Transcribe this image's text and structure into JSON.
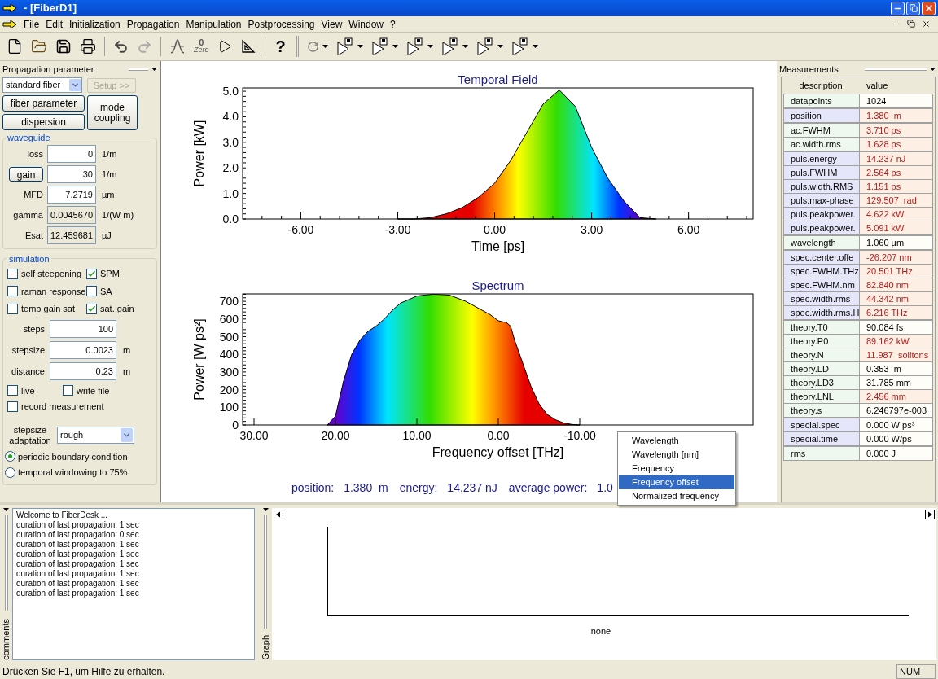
{
  "window": {
    "title": "- [FiberD1]"
  },
  "menu": [
    "File",
    "Edit",
    "Initialization",
    "Propagation",
    "Manipulation",
    "Postprocessing",
    "View",
    "Window",
    "?"
  ],
  "toolbar": {
    "zero_digit": "0",
    "zero_caption": "Zero",
    "help": "?"
  },
  "propagation_panel": {
    "title": "Propagation parameter",
    "fiber_type": "standard fiber",
    "setup_button": {
      "label": "Setup >>",
      "disabled": true
    },
    "buttons": [
      "fiber parameter",
      "dispersion"
    ],
    "mode_button": "mode coupling"
  },
  "waveguide": {
    "title": "waveguide",
    "fields": [
      {
        "label": "loss",
        "kind": "text",
        "value": "0",
        "unit": "1/m",
        "readonly": false
      },
      {
        "label": "gain",
        "kind": "button",
        "value": "30",
        "unit": "1/m",
        "readonly": false
      },
      {
        "label": "MFD",
        "kind": "text",
        "value": "7.2719",
        "unit": "µm",
        "readonly": false
      },
      {
        "label": "gamma",
        "kind": "text",
        "value": "0.0045670",
        "unit": "1/(W m)",
        "readonly": true
      },
      {
        "label": "Esat",
        "kind": "text",
        "value": "12.459681",
        "unit": "µJ",
        "readonly": true
      }
    ]
  },
  "simulation": {
    "title": "simulation",
    "options": [
      {
        "label": "self steepening",
        "checked": false
      },
      {
        "label": "SPM",
        "checked": true
      },
      {
        "label": "raman response",
        "checked": false
      },
      {
        "label": "SA",
        "checked": false
      },
      {
        "label": "temp gain sat",
        "checked": false
      },
      {
        "label": "sat. gain",
        "checked": true
      }
    ],
    "fields": [
      {
        "label": "steps",
        "value": "100"
      },
      {
        "label": "stepsize",
        "value": "0.0023",
        "unit": "m"
      },
      {
        "label": "distance",
        "value": "0.23",
        "unit": "m"
      }
    ],
    "output_options": [
      {
        "label": "live",
        "checked": false
      },
      {
        "label": "write file",
        "checked": false
      },
      {
        "label": "record measurement",
        "checked": false
      }
    ],
    "adaptation": {
      "label": "stepsize adaptation",
      "value": "rough"
    },
    "boundary": [
      {
        "label": "periodic boundary condition",
        "selected": true
      },
      {
        "label": "temporal windowing to 75%",
        "selected": false
      }
    ]
  },
  "temporal_plot": {
    "chart_data": {
      "type": "area",
      "title": "Temporal Field",
      "xlabel": "Time [ps]",
      "ylabel": "Power [kW]",
      "xlim": [
        -7.8,
        8.0
      ],
      "ylim": [
        0,
        5.13
      ],
      "xticks": [
        {
          "value": -6,
          "label": "-6.00"
        },
        {
          "value": -3,
          "label": "-3.00"
        },
        {
          "value": 0,
          "label": "0.00"
        },
        {
          "value": 3,
          "label": "3.00"
        },
        {
          "value": 6,
          "label": "6.00"
        }
      ],
      "yticks": [
        {
          "value": 0,
          "label": "0.0"
        },
        {
          "value": 1,
          "label": "1.0"
        },
        {
          "value": 2,
          "label": "2.0"
        },
        {
          "value": 3,
          "label": "3.0"
        },
        {
          "value": 4,
          "label": "4.0"
        },
        {
          "value": 5,
          "label": "5.0"
        }
      ],
      "x": [
        -3,
        -2.5,
        -2,
        -1.5,
        -1,
        -0.5,
        0,
        0.5,
        1,
        1.5,
        2,
        2.5,
        3,
        3.5,
        4,
        4.5,
        5
      ],
      "values": [
        0,
        0,
        0.05,
        0.2,
        0.45,
        0.85,
        1.4,
        2.3,
        3.4,
        4.5,
        5.05,
        4.4,
        2.8,
        1.6,
        0.7,
        0.05,
        0
      ]
    }
  },
  "spectrum_plot": {
    "chart_data": {
      "type": "area",
      "title": "Spectrum",
      "xlabel": "Frequency offset [THz]",
      "ylabel": "Power [W ps²]",
      "xlim": [
        31.4,
        -31.3
      ],
      "ylim": [
        0,
        742
      ],
      "xticks": [
        {
          "value": 30,
          "label": "30.00"
        },
        {
          "value": 20,
          "label": "20.00"
        },
        {
          "value": 10,
          "label": "10.00"
        },
        {
          "value": 0,
          "label": "0.00"
        },
        {
          "value": -10,
          "label": "-10.00"
        }
      ],
      "yticks": [
        0,
        100,
        200,
        300,
        400,
        500,
        600,
        700
      ],
      "x": [
        21,
        20,
        19,
        18,
        17,
        16,
        15,
        14,
        13,
        12,
        10,
        8,
        6,
        4,
        2,
        1,
        0,
        -1,
        -1.5,
        -2,
        -3,
        -4,
        -5,
        -6,
        -7,
        -8,
        -9,
        -10
      ],
      "values": [
        0,
        50,
        250,
        400,
        480,
        530,
        560,
        600,
        650,
        690,
        730,
        740,
        735,
        700,
        650,
        625,
        590,
        580,
        560,
        480,
        350,
        220,
        120,
        60,
        30,
        12,
        3,
        0
      ]
    }
  },
  "readout": [
    {
      "label": "position:",
      "value": "1.380  m"
    },
    {
      "label": "energy:",
      "value": "14.237 nJ"
    },
    {
      "label": "average power:",
      "value": "1.0"
    }
  ],
  "context_menu": [
    {
      "label": "Wavelength",
      "selected": false
    },
    {
      "label": "Wavelength [nm]",
      "selected": false
    },
    {
      "label": "Frequency",
      "selected": false
    },
    {
      "label": "Frequency offset",
      "selected": true
    },
    {
      "label": "Normalized frequency",
      "selected": false
    }
  ],
  "measurements": {
    "title": "Measurements",
    "columns": [
      "description",
      "value"
    ],
    "groups": [
      {
        "rows": [
          {
            "description": "datapoints",
            "value": "1024",
            "highlighted": false
          }
        ]
      },
      {
        "rows": [
          {
            "description": "position",
            "value": "1.380  m",
            "highlighted": true
          }
        ]
      },
      {
        "rows": [
          {
            "description": "ac.FWHM",
            "value": "3.710 ps",
            "highlighted": true
          },
          {
            "description": "ac.width.rms",
            "value": "1.628 ps",
            "highlighted": true
          }
        ]
      },
      {
        "rows": [
          {
            "description": "puls.energy",
            "value": "14.237 nJ",
            "highlighted": true
          },
          {
            "description": "puls.FWHM",
            "value": "2.564 ps",
            "highlighted": true
          },
          {
            "description": "puls.width.RMS",
            "value": "1.151 ps",
            "highlighted": true
          },
          {
            "description": "puls.max-phase",
            "value": "129.507  rad",
            "highlighted": true
          },
          {
            "description": "puls.peakpower.",
            "value": "4.622 kW",
            "highlighted": true
          },
          {
            "description": "puls.peakpower.",
            "value": "5.091 kW",
            "highlighted": true
          }
        ]
      },
      {
        "rows": [
          {
            "description": "wavelength",
            "value": "1.060 µm",
            "highlighted": false
          }
        ]
      },
      {
        "rows": [
          {
            "description": "spec.center.offe",
            "value": "-26.207 nm",
            "highlighted": true
          },
          {
            "description": "spec.FWHM.THz",
            "value": "20.501 THz",
            "highlighted": true
          },
          {
            "description": "spec.FWHM.nm",
            "value": "82.840 nm",
            "highlighted": true
          },
          {
            "description": "spec.width.rms",
            "value": "44.342 nm",
            "highlighted": true
          },
          {
            "description": "spec.width.rms.H",
            "value": "6.216 THz",
            "highlighted": true
          }
        ]
      },
      {
        "rows": [
          {
            "description": "theory.T0",
            "value": "90.084 fs",
            "highlighted": false
          },
          {
            "description": "theory.P0",
            "value": "89.162 kW",
            "highlighted": true
          },
          {
            "description": "theory.N",
            "value": "11.987  solitons",
            "highlighted": true
          },
          {
            "description": "theory.LD",
            "value": "0.353  m",
            "highlighted": false
          },
          {
            "description": "theory.LD3",
            "value": "31.785 mm",
            "highlighted": false
          },
          {
            "description": "theory.LNL",
            "value": "2.456 mm",
            "highlighted": true
          },
          {
            "description": "theory.s",
            "value": "6.246797e-003",
            "highlighted": false
          }
        ]
      },
      {
        "rows": [
          {
            "description": "special.spec",
            "value": "0.000 W ps³",
            "highlighted": false
          },
          {
            "description": "special.time",
            "value": "0.000 W/ps",
            "highlighted": false
          }
        ]
      },
      {
        "rows": [
          {
            "description": "rms",
            "value": "0.000 J",
            "highlighted": false
          }
        ]
      }
    ]
  },
  "comments": {
    "title": "comments",
    "lines": [
      "Welcome to FiberDesk ...",
      "duration of last propagation: 1 sec",
      "duration of last propagation: 0 sec",
      "duration of last propagation: 1 sec",
      "duration of last propagation: 1 sec",
      "duration of last propagation: 1 sec",
      "duration of last propagation: 1 sec",
      "duration of last propagation: 1 sec",
      "duration of last propagation: 1 sec"
    ]
  },
  "graph": {
    "title": "Graph",
    "caption": "none"
  },
  "status_bar": {
    "message": "Drücken Sie F1, um Hilfe zu erhalten.",
    "indicator": "NUM"
  }
}
